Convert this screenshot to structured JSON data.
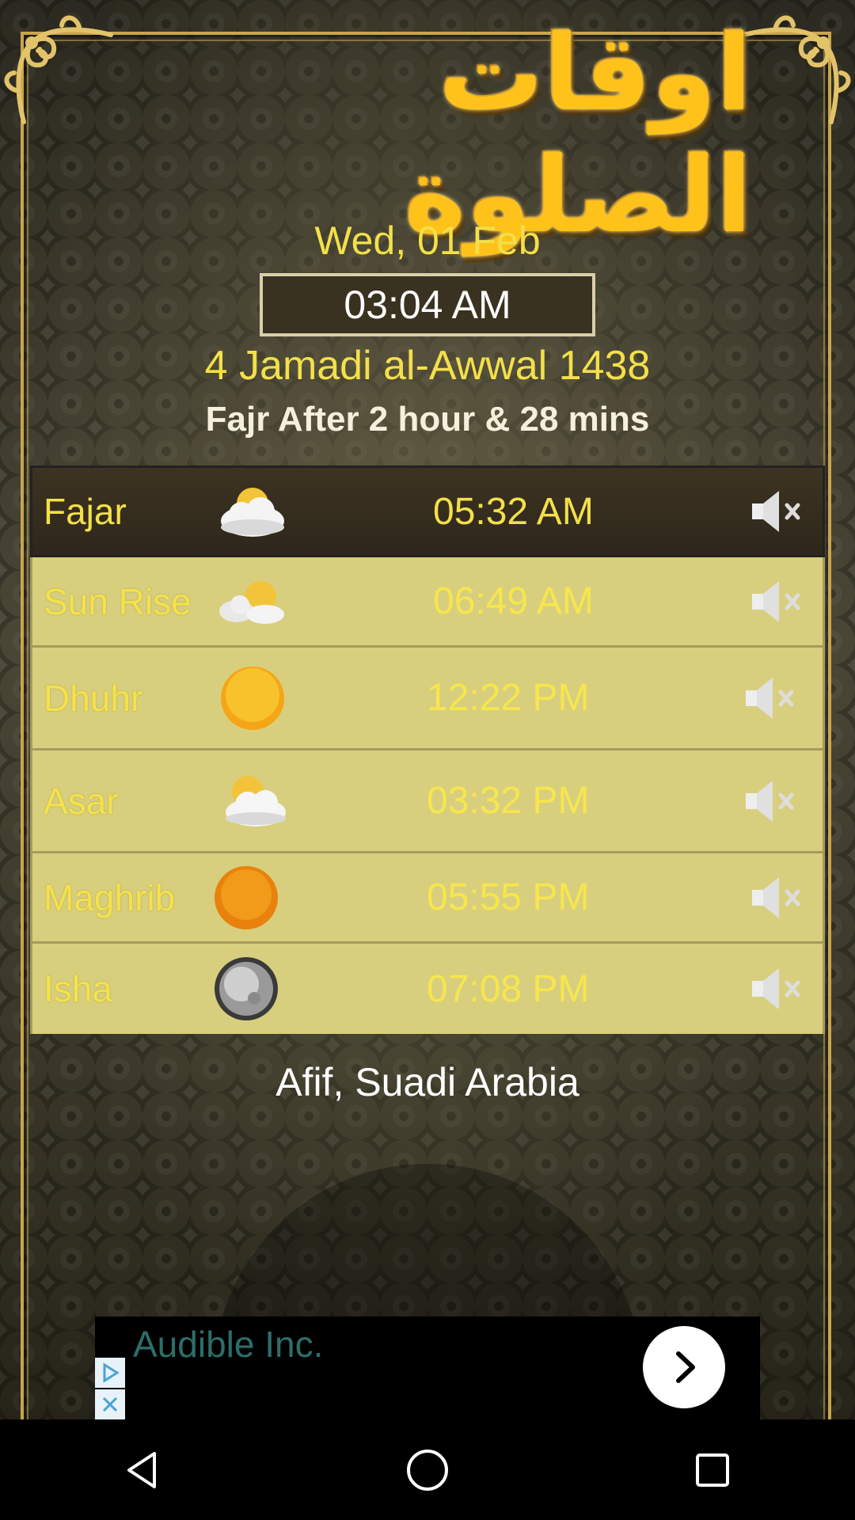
{
  "header": {
    "title": "اوقات الصلوة",
    "date": "Wed, 01 Feb",
    "current_time": "03:04 AM",
    "hijri_date": "4 Jamadi al-Awwal 1438",
    "next_prayer": "Fajr After 2 hour & 28 mins"
  },
  "prayers": [
    {
      "name": "Fajar",
      "icon": "cloud-icon",
      "time": "05:32 AM",
      "active": true,
      "sound": "muted"
    },
    {
      "name": "Sun Rise",
      "icon": "sunrise-clouds-icon",
      "time": "06:49 AM",
      "active": false,
      "sound": "muted"
    },
    {
      "name": "Dhuhr",
      "icon": "sun-icon",
      "time": "12:22 PM",
      "active": false,
      "sound": "muted"
    },
    {
      "name": "Asar",
      "icon": "partly-cloudy-icon",
      "time": "03:32 PM",
      "active": false,
      "sound": "muted"
    },
    {
      "name": "Maghrib",
      "icon": "sunset-icon",
      "time": "05:55 PM",
      "active": false,
      "sound": "muted"
    },
    {
      "name": "Isha",
      "icon": "moon-icon",
      "time": "07:08 PM",
      "active": false,
      "sound": "muted"
    }
  ],
  "location": "Afif, Suadi Arabia",
  "ad": {
    "text": "Audible Inc."
  },
  "colors": {
    "accent_yellow": "#f3e04a",
    "frame_gold": "#c9a54c",
    "row_bg": "#d8cf7e",
    "active_row_bg": "#2e271a"
  }
}
